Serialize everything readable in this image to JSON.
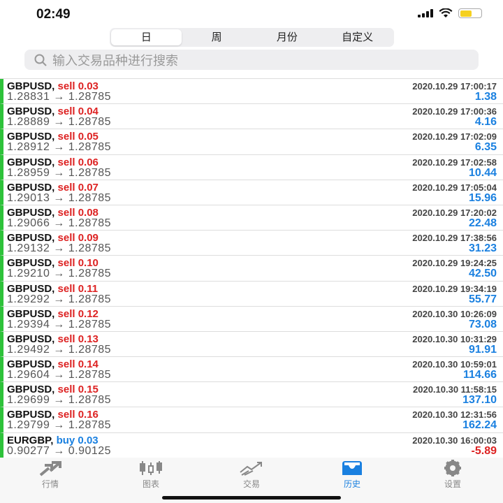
{
  "status": {
    "time": "02:49"
  },
  "segments": [
    "日",
    "周",
    "月份",
    "自定义"
  ],
  "search": {
    "placeholder": "输入交易品种进行搜索"
  },
  "rows": [
    {
      "symbol": "GBPUSD,",
      "side": "sell 0.03",
      "type": "sell",
      "prices": "1.28831 → 1.28785",
      "datetime": "2020.10.29 17:00:17",
      "profit": "1.38"
    },
    {
      "symbol": "GBPUSD,",
      "side": "sell 0.04",
      "type": "sell",
      "prices": "1.28889 → 1.28785",
      "datetime": "2020.10.29 17:00:36",
      "profit": "4.16"
    },
    {
      "symbol": "GBPUSD,",
      "side": "sell 0.05",
      "type": "sell",
      "prices": "1.28912 → 1.28785",
      "datetime": "2020.10.29 17:02:09",
      "profit": "6.35"
    },
    {
      "symbol": "GBPUSD,",
      "side": "sell 0.06",
      "type": "sell",
      "prices": "1.28959 → 1.28785",
      "datetime": "2020.10.29 17:02:58",
      "profit": "10.44"
    },
    {
      "symbol": "GBPUSD,",
      "side": "sell 0.07",
      "type": "sell",
      "prices": "1.29013 → 1.28785",
      "datetime": "2020.10.29 17:05:04",
      "profit": "15.96"
    },
    {
      "symbol": "GBPUSD,",
      "side": "sell 0.08",
      "type": "sell",
      "prices": "1.29066 → 1.28785",
      "datetime": "2020.10.29 17:20:02",
      "profit": "22.48"
    },
    {
      "symbol": "GBPUSD,",
      "side": "sell 0.09",
      "type": "sell",
      "prices": "1.29132 → 1.28785",
      "datetime": "2020.10.29 17:38:56",
      "profit": "31.23"
    },
    {
      "symbol": "GBPUSD,",
      "side": "sell 0.10",
      "type": "sell",
      "prices": "1.29210 → 1.28785",
      "datetime": "2020.10.29 19:24:25",
      "profit": "42.50"
    },
    {
      "symbol": "GBPUSD,",
      "side": "sell 0.11",
      "type": "sell",
      "prices": "1.29292 → 1.28785",
      "datetime": "2020.10.29 19:34:19",
      "profit": "55.77"
    },
    {
      "symbol": "GBPUSD,",
      "side": "sell 0.12",
      "type": "sell",
      "prices": "1.29394 → 1.28785",
      "datetime": "2020.10.30 10:26:09",
      "profit": "73.08"
    },
    {
      "symbol": "GBPUSD,",
      "side": "sell 0.13",
      "type": "sell",
      "prices": "1.29492 → 1.28785",
      "datetime": "2020.10.30 10:31:29",
      "profit": "91.91"
    },
    {
      "symbol": "GBPUSD,",
      "side": "sell 0.14",
      "type": "sell",
      "prices": "1.29604 → 1.28785",
      "datetime": "2020.10.30 10:59:01",
      "profit": "114.66"
    },
    {
      "symbol": "GBPUSD,",
      "side": "sell 0.15",
      "type": "sell",
      "prices": "1.29699 → 1.28785",
      "datetime": "2020.10.30 11:58:15",
      "profit": "137.10"
    },
    {
      "symbol": "GBPUSD,",
      "side": "sell 0.16",
      "type": "sell",
      "prices": "1.29799 → 1.28785",
      "datetime": "2020.10.30 12:31:56",
      "profit": "162.24"
    },
    {
      "symbol": "EURGBP,",
      "side": "buy 0.03",
      "type": "buy",
      "prices": "0.90277 → 0.90125",
      "datetime": "2020.10.30 16:00:03",
      "profit": "-5.89"
    }
  ],
  "tabbar": [
    {
      "label": "行情",
      "icon": "quotes-icon"
    },
    {
      "label": "图表",
      "icon": "candlestick-chart-icon"
    },
    {
      "label": "交易",
      "icon": "trade-icon"
    },
    {
      "label": "历史",
      "icon": "history-inbox-icon",
      "active": true
    },
    {
      "label": "设置",
      "icon": "gear-icon"
    }
  ],
  "colors": {
    "accent": "#1a80e0",
    "sell": "#dd2222",
    "positive_bar": "#2ec23a"
  }
}
